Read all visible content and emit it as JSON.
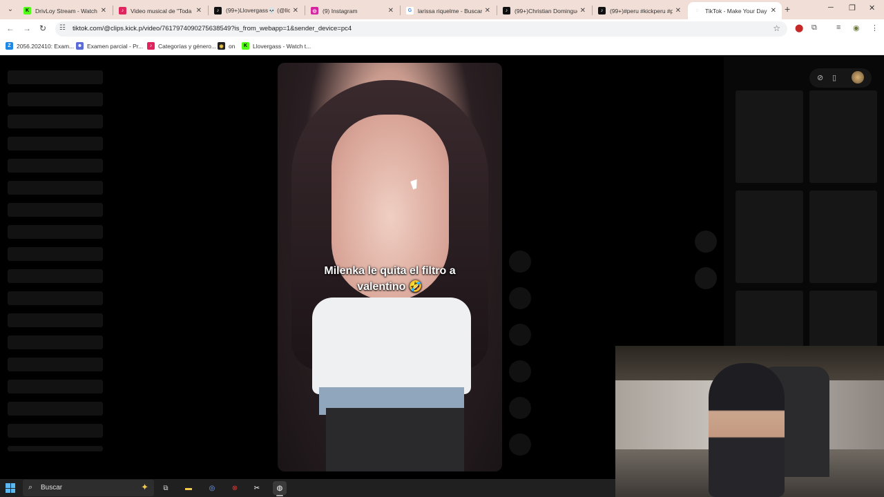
{
  "tabs": [
    {
      "title": "DrivLoy Stream - Watch Li",
      "favicon_color": "#53fc18",
      "favicon_glyph": "K"
    },
    {
      "title": "Video musical de \"Toda L",
      "favicon_color": "#e0245e",
      "favicon_glyph": "♪"
    },
    {
      "title": "(99+)Llovergass💀 (@llov",
      "favicon_color": "#111111",
      "favicon_glyph": "♪"
    },
    {
      "title": "(9) Instagram",
      "favicon_color": "#d6249f",
      "favicon_glyph": "◎"
    },
    {
      "title": "larissa riquelme - Buscar c",
      "favicon_color": "#4285f4",
      "favicon_glyph": "G"
    },
    {
      "title": "(99+)Christian Domingue",
      "favicon_color": "#111111",
      "favicon_glyph": "♪"
    },
    {
      "title": "(99+)#peru #kickperu #p",
      "favicon_color": "#111111",
      "favicon_glyph": "♪"
    },
    {
      "title": "TikTok - Make Your Day",
      "favicon_color": "#999999",
      "favicon_glyph": "◌"
    }
  ],
  "address_bar": {
    "url": "tiktok.com/@clips.kick.p/video/7617974090275638549?is_from_webapp=1&sender_device=pc4"
  },
  "bookmarks": [
    {
      "label": "2056.202410: Exam...",
      "color": "#1e88e5",
      "glyph": "Z"
    },
    {
      "label": "Examen parcial - Pr...",
      "color": "#5b6bd8",
      "glyph": "☻"
    },
    {
      "label": "Categorías y género...",
      "color": "#e0245e",
      "glyph": "♪"
    },
    {
      "label": "on",
      "color": "#222222",
      "glyph": "◉"
    },
    {
      "label": "Llovergass - Watch t...",
      "color": "#53fc18",
      "glyph": "K"
    }
  ],
  "video": {
    "caption_line1": "Milenka le quita el filtro a",
    "caption_line2": "valentino 🤣"
  },
  "taskbar": {
    "search_placeholder": "Buscar"
  },
  "icons": {
    "tab_search": "chevron-down-icon",
    "close": "close-icon",
    "new_tab": "plus-icon",
    "back": "back-arrow-icon",
    "forward": "forward-arrow-icon",
    "reload": "reload-icon",
    "site_info": "site-info-icon",
    "bookmark_star": "star-icon"
  }
}
